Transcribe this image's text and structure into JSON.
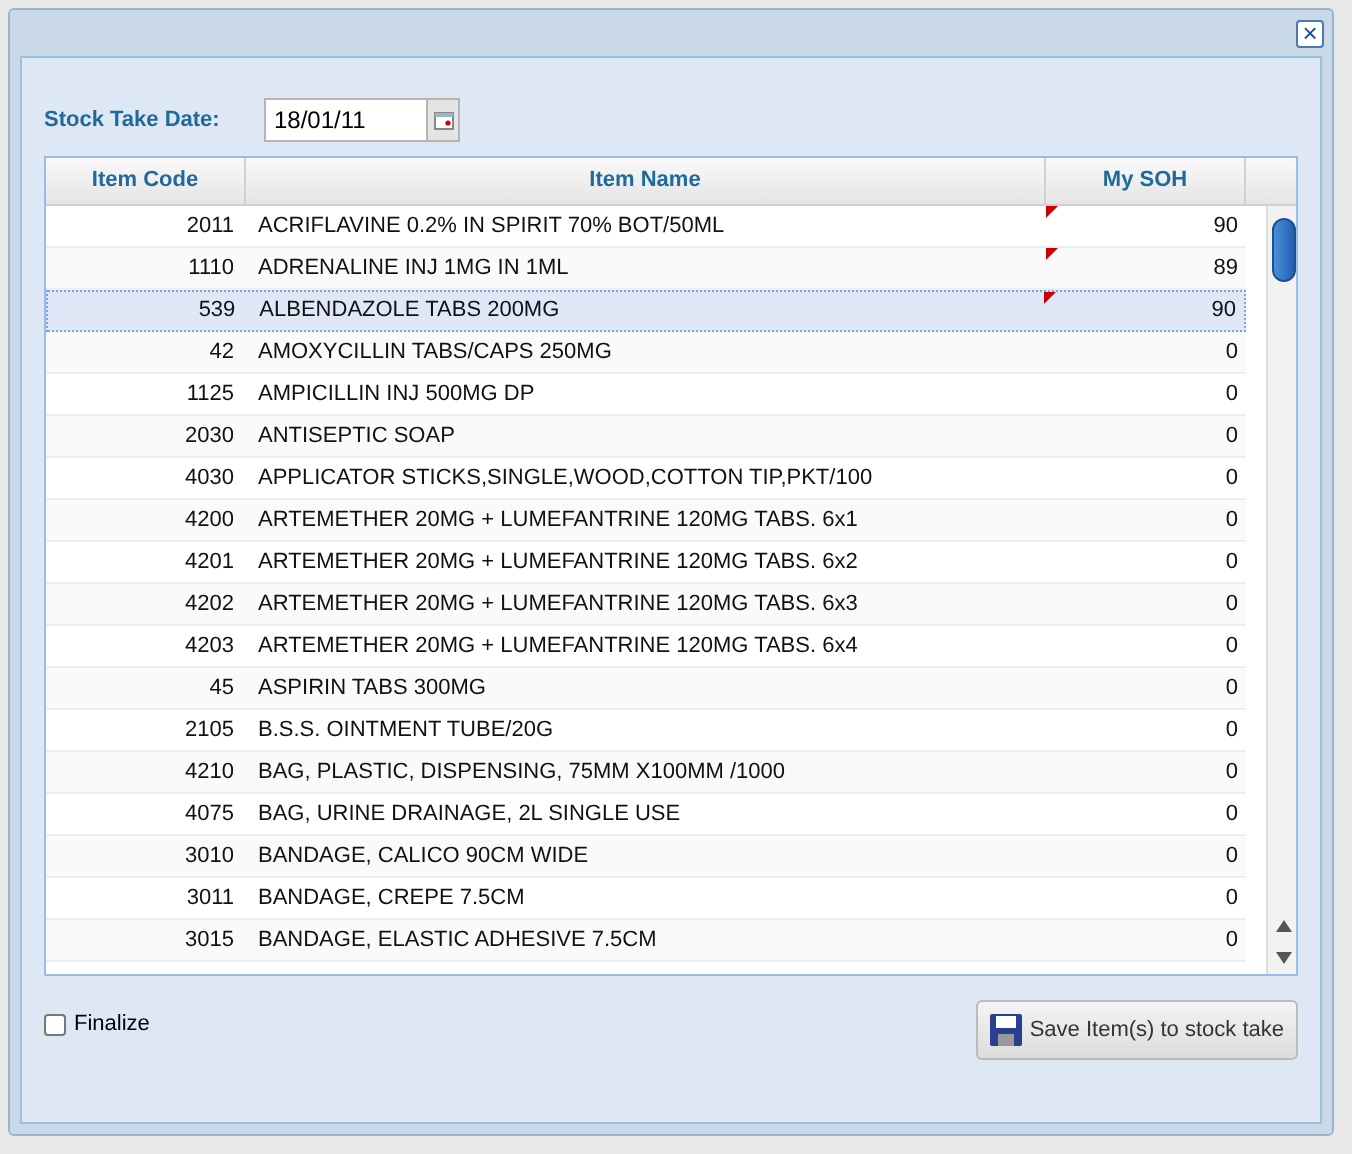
{
  "form": {
    "date_label": "Stock Take Date:",
    "date_value": "18/01/11"
  },
  "table": {
    "columns": [
      "Item Code",
      "Item Name",
      "My SOH"
    ],
    "rows": [
      {
        "code": "2011",
        "name": "ACRIFLAVINE 0.2% IN SPIRIT 70% BOT/50ML",
        "soh": "90",
        "edited": true,
        "selected": false
      },
      {
        "code": "1110",
        "name": "ADRENALINE INJ 1MG IN 1ML",
        "soh": "89",
        "edited": true,
        "selected": false
      },
      {
        "code": "539",
        "name": "ALBENDAZOLE TABS 200MG",
        "soh": "90",
        "edited": true,
        "selected": true
      },
      {
        "code": "42",
        "name": "AMOXYCILLIN TABS/CAPS 250MG",
        "soh": "0",
        "edited": false,
        "selected": false
      },
      {
        "code": "1125",
        "name": "AMPICILLIN INJ 500MG DP",
        "soh": "0",
        "edited": false,
        "selected": false
      },
      {
        "code": "2030",
        "name": "ANTISEPTIC SOAP",
        "soh": "0",
        "edited": false,
        "selected": false
      },
      {
        "code": "4030",
        "name": "APPLICATOR STICKS,SINGLE,WOOD,COTTON TIP,PKT/100",
        "soh": "0",
        "edited": false,
        "selected": false
      },
      {
        "code": "4200",
        "name": "ARTEMETHER 20MG + LUMEFANTRINE 120MG TABS. 6x1",
        "soh": "0",
        "edited": false,
        "selected": false
      },
      {
        "code": "4201",
        "name": "ARTEMETHER 20MG + LUMEFANTRINE 120MG TABS. 6x2",
        "soh": "0",
        "edited": false,
        "selected": false
      },
      {
        "code": "4202",
        "name": "ARTEMETHER 20MG + LUMEFANTRINE 120MG TABS. 6x3",
        "soh": "0",
        "edited": false,
        "selected": false
      },
      {
        "code": "4203",
        "name": "ARTEMETHER 20MG + LUMEFANTRINE 120MG TABS. 6x4",
        "soh": "0",
        "edited": false,
        "selected": false
      },
      {
        "code": "45",
        "name": "ASPIRIN TABS 300MG",
        "soh": "0",
        "edited": false,
        "selected": false
      },
      {
        "code": "2105",
        "name": "B.S.S. OINTMENT TUBE/20G",
        "soh": "0",
        "edited": false,
        "selected": false
      },
      {
        "code": "4210",
        "name": "BAG, PLASTIC, DISPENSING, 75MM X100MM /1000",
        "soh": "0",
        "edited": false,
        "selected": false
      },
      {
        "code": "4075",
        "name": "BAG, URINE DRAINAGE, 2L SINGLE USE",
        "soh": "0",
        "edited": false,
        "selected": false
      },
      {
        "code": "3010",
        "name": "BANDAGE, CALICO 90CM WIDE",
        "soh": "0",
        "edited": false,
        "selected": false
      },
      {
        "code": "3011",
        "name": "BANDAGE, CREPE 7.5CM",
        "soh": "0",
        "edited": false,
        "selected": false
      },
      {
        "code": "3015",
        "name": "BANDAGE, ELASTIC ADHESIVE 7.5CM",
        "soh": "0",
        "edited": false,
        "selected": false
      }
    ]
  },
  "finalize": {
    "label": "Finalize",
    "checked": false
  },
  "save_button": {
    "label": "Save Item(s) to stock take"
  },
  "close_button": {
    "label": "×"
  }
}
